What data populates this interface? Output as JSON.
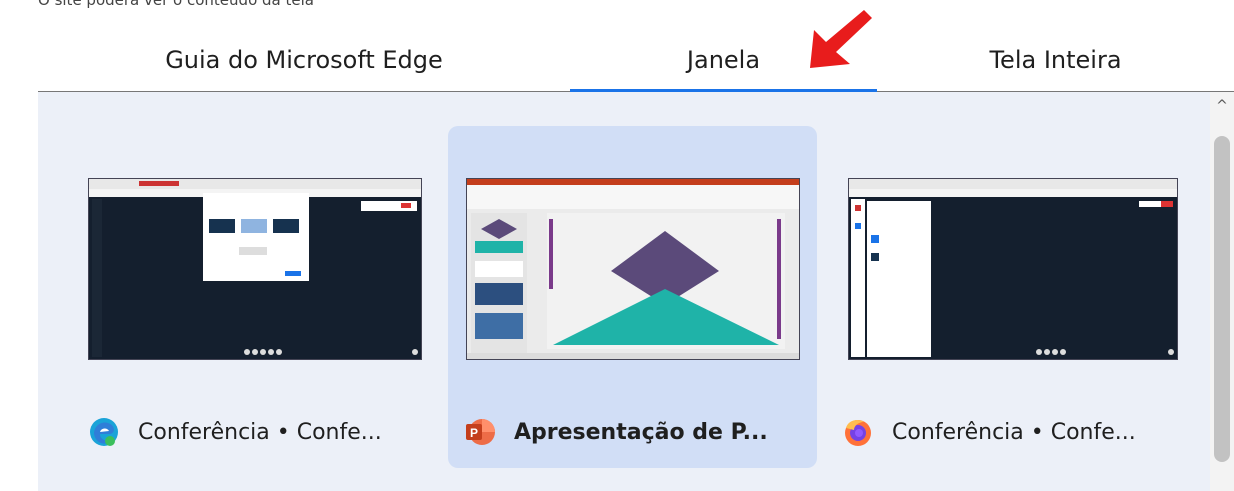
{
  "header": {
    "note": "O site poderá ver o conteúdo da tela"
  },
  "tabs": [
    {
      "label": "Guia do Microsoft Edge",
      "selected": false
    },
    {
      "label": "Janela",
      "selected": true
    },
    {
      "label": "Tela Inteira",
      "selected": false
    }
  ],
  "colors": {
    "accent": "#1a73e8",
    "arrow": "#e81c1c",
    "panel": "#ecf0f8",
    "selected_card": "#d1def6"
  },
  "windows": [
    {
      "title": "Conferência • Confe...",
      "app_icon": "edge-icon",
      "selected": false
    },
    {
      "title": "Apresentação de P...",
      "app_icon": "powerpoint-icon",
      "selected": true
    },
    {
      "title": "Conferência • Confe...",
      "app_icon": "firefox-icon",
      "selected": false
    }
  ]
}
